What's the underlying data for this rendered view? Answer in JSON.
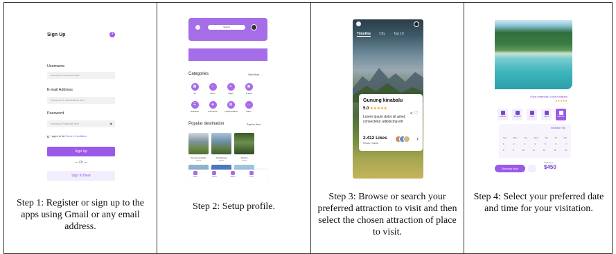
{
  "steps": [
    {
      "caption": "Step 1: Register or sign up to the apps using Gmail or any email address."
    },
    {
      "caption": "Step 2: Setup profile."
    },
    {
      "caption": "Step 3: Browse or search your preferred attraction to visit and then select the chosen attraction of place to visit."
    },
    {
      "caption": "Step 4: Select your preferred date and time for your visitation."
    }
  ],
  "signup": {
    "title": "Sign Up",
    "help_icon": "question-icon",
    "username_label": "Username",
    "username_placeholder": "Insert your Username here",
    "email_label": "E-mail Address",
    "email_placeholder": "Insert your E-mail Address here",
    "password_label": "Password",
    "password_placeholder": "Insert your Password here",
    "terms_prefix": "I agree to the",
    "terms_link": "Terms & Conditions",
    "signup_button": "Sign Up",
    "or_text": "— Or —",
    "signin_button": "Sign In Here",
    "accent": "#9b59e8"
  },
  "profile": {
    "search_text": "Search",
    "categories_title": "Categories",
    "categories_more": "View More →",
    "categories": [
      {
        "label": "All",
        "icon": "grid-icon"
      },
      {
        "label": "Hotel",
        "icon": "hotel-icon"
      },
      {
        "label": "Flight",
        "icon": "plane-icon"
      },
      {
        "label": "Travel",
        "icon": "suitcase-icon"
      },
      {
        "label": "Activities",
        "icon": "activity-icon"
      },
      {
        "label": "Insurance",
        "icon": "shield-icon"
      },
      {
        "label": "Transportation",
        "icon": "bus-icon"
      },
      {
        "label": "Other",
        "icon": "more-icon"
      }
    ],
    "popular_title": "Popular destination",
    "popular_more": "Explore Now →",
    "destinations": [
      {
        "name": "Gunung kinabalu",
        "sub": "Sabah"
      },
      {
        "name": "Kundasang",
        "sub": "Sabah"
      },
      {
        "name": "Sepilok",
        "sub": "Sabah"
      }
    ],
    "nav": [
      "Home",
      "Travel",
      "Saved",
      "Inbox"
    ]
  },
  "browse": {
    "tabs": [
      "Timeline",
      "City",
      "Top 10"
    ],
    "name": "Gunung kinabalu",
    "rating": "5.0",
    "stars": "★★★★★",
    "description": "Lorem ipsum dolor sit amet, consectetur adipiscing elit",
    "likes": "2.412 Likes",
    "location": "Ranau, Sabah"
  },
  "booking": {
    "title": "Pulau mamutik, Kota Kinabalu",
    "stars": "★★★★★",
    "options": [
      "Location",
      "Transport",
      "Hotel",
      "Flight",
      "Calendar"
    ],
    "calendar_title": "Schedule Trip",
    "calendar_days": [
      "Sun",
      "Mon",
      "Tue",
      "Wed",
      "Thu",
      "Fri",
      "Sat"
    ],
    "calendar_week1": [
      "1",
      "2",
      "3",
      "4",
      "5",
      "6",
      "7"
    ],
    "calendar_week2": [
      "8",
      "9",
      "10",
      "11",
      "12",
      "13",
      "14"
    ],
    "price_label": "Total Price",
    "price": "$450",
    "book_button": "Booking Now"
  }
}
